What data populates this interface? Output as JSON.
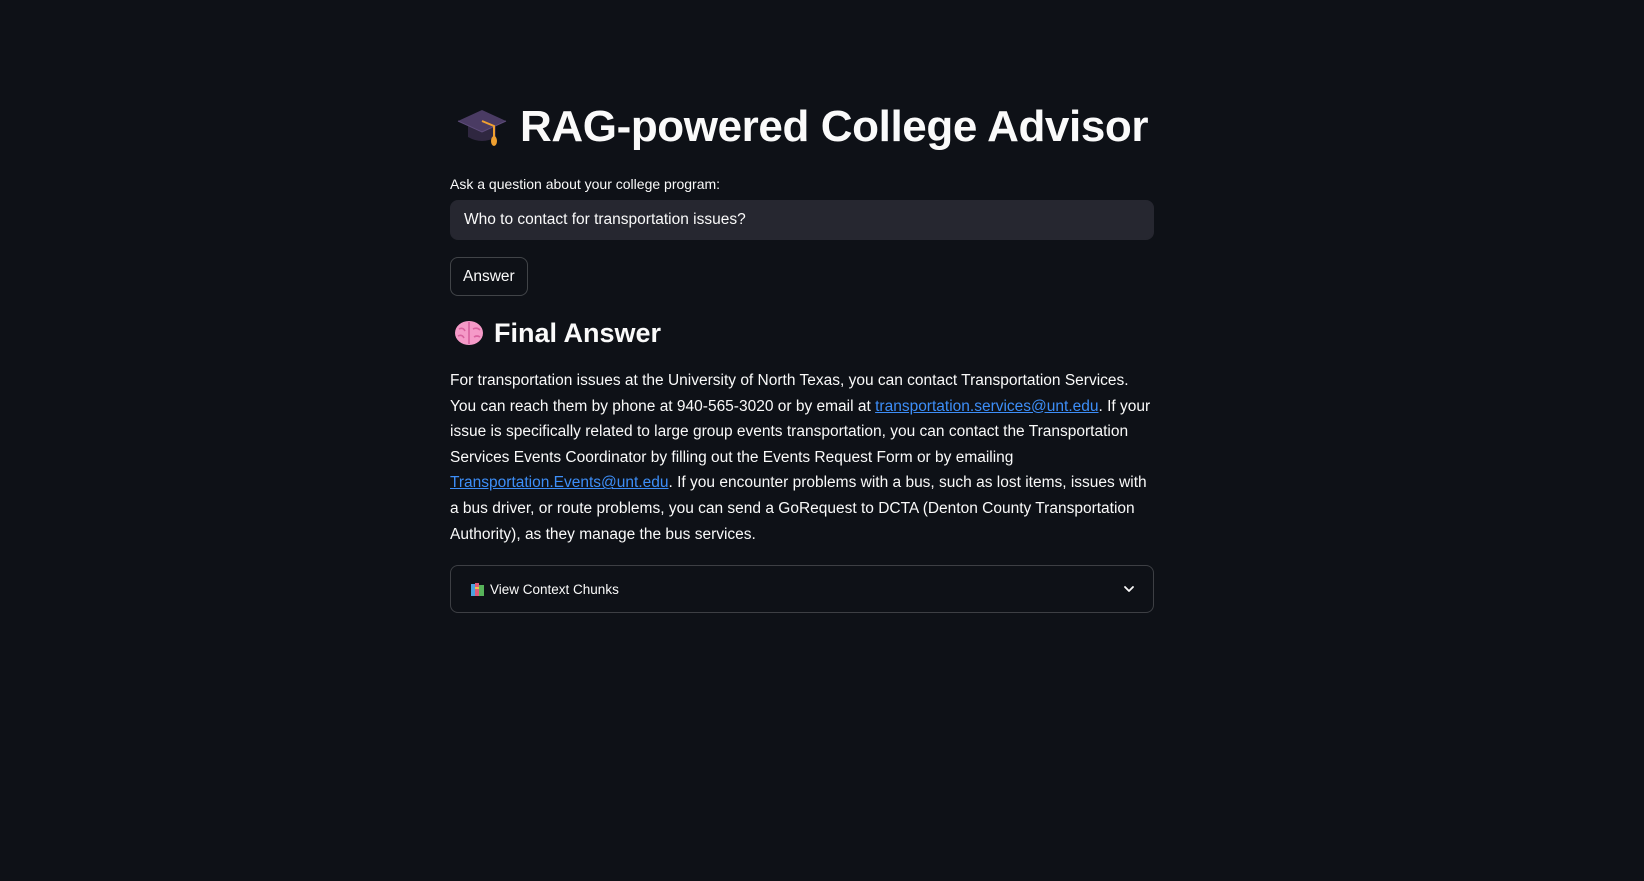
{
  "header": {
    "title": "RAG-powered College Advisor",
    "icon": "graduation-cap-icon"
  },
  "question": {
    "label": "Ask a question about your college program:",
    "value": "Who to contact for transportation issues?"
  },
  "actions": {
    "answer_label": "Answer"
  },
  "final_answer": {
    "heading": "Final Answer",
    "icon": "brain-icon",
    "text_1": "For transportation issues at the University of North Texas, you can contact Transportation Services. You can reach them by phone at 940-565-3020 or by email at ",
    "link_1": "transportation.services@unt.edu",
    "text_2": ". If your issue is specifically related to large group events transportation, you can contact the Transportation Services Events Coordinator by filling out the Events Request Form or by emailing ",
    "link_2": "Transportation.Events@unt.edu",
    "text_3": ". If you encounter problems with a bus, such as lost items, issues with a bus driver, or route problems, you can send a GoRequest to DCTA (Denton County Transportation Authority), as they manage the bus services."
  },
  "context": {
    "expander_label": "View Context Chunks",
    "icon": "books-icon",
    "toggle_icon": "chevron-down-icon"
  },
  "colors": {
    "background": "#0e1117",
    "input_background": "#262730",
    "text": "#fafafa",
    "link": "#3d8ef8"
  }
}
